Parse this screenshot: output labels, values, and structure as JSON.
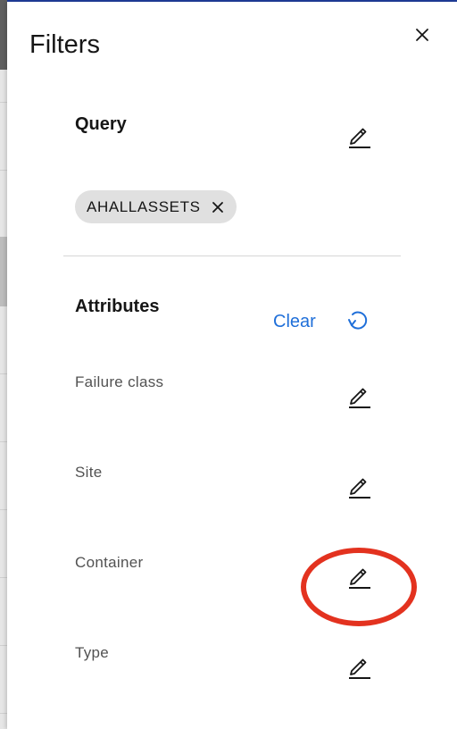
{
  "panel": {
    "title": "Filters"
  },
  "query": {
    "heading": "Query",
    "tags": [
      {
        "label": "AHALLASSETS"
      }
    ]
  },
  "attributes": {
    "heading": "Attributes",
    "clear_label": "Clear",
    "items": [
      {
        "label": "Failure class"
      },
      {
        "label": "Site"
      },
      {
        "label": "Container"
      },
      {
        "label": "Type"
      }
    ]
  },
  "icons": {
    "close": "close-icon",
    "edit": "pencil-icon",
    "tag_remove": "close-icon",
    "reset": "reset-icon"
  },
  "colors": {
    "text_primary": "#161616",
    "text_secondary": "#525252",
    "link": "#1f6fd9",
    "tag_bg": "#e0e0e0",
    "highlight": "#e3321f",
    "top_rule": "#1f3d99"
  }
}
